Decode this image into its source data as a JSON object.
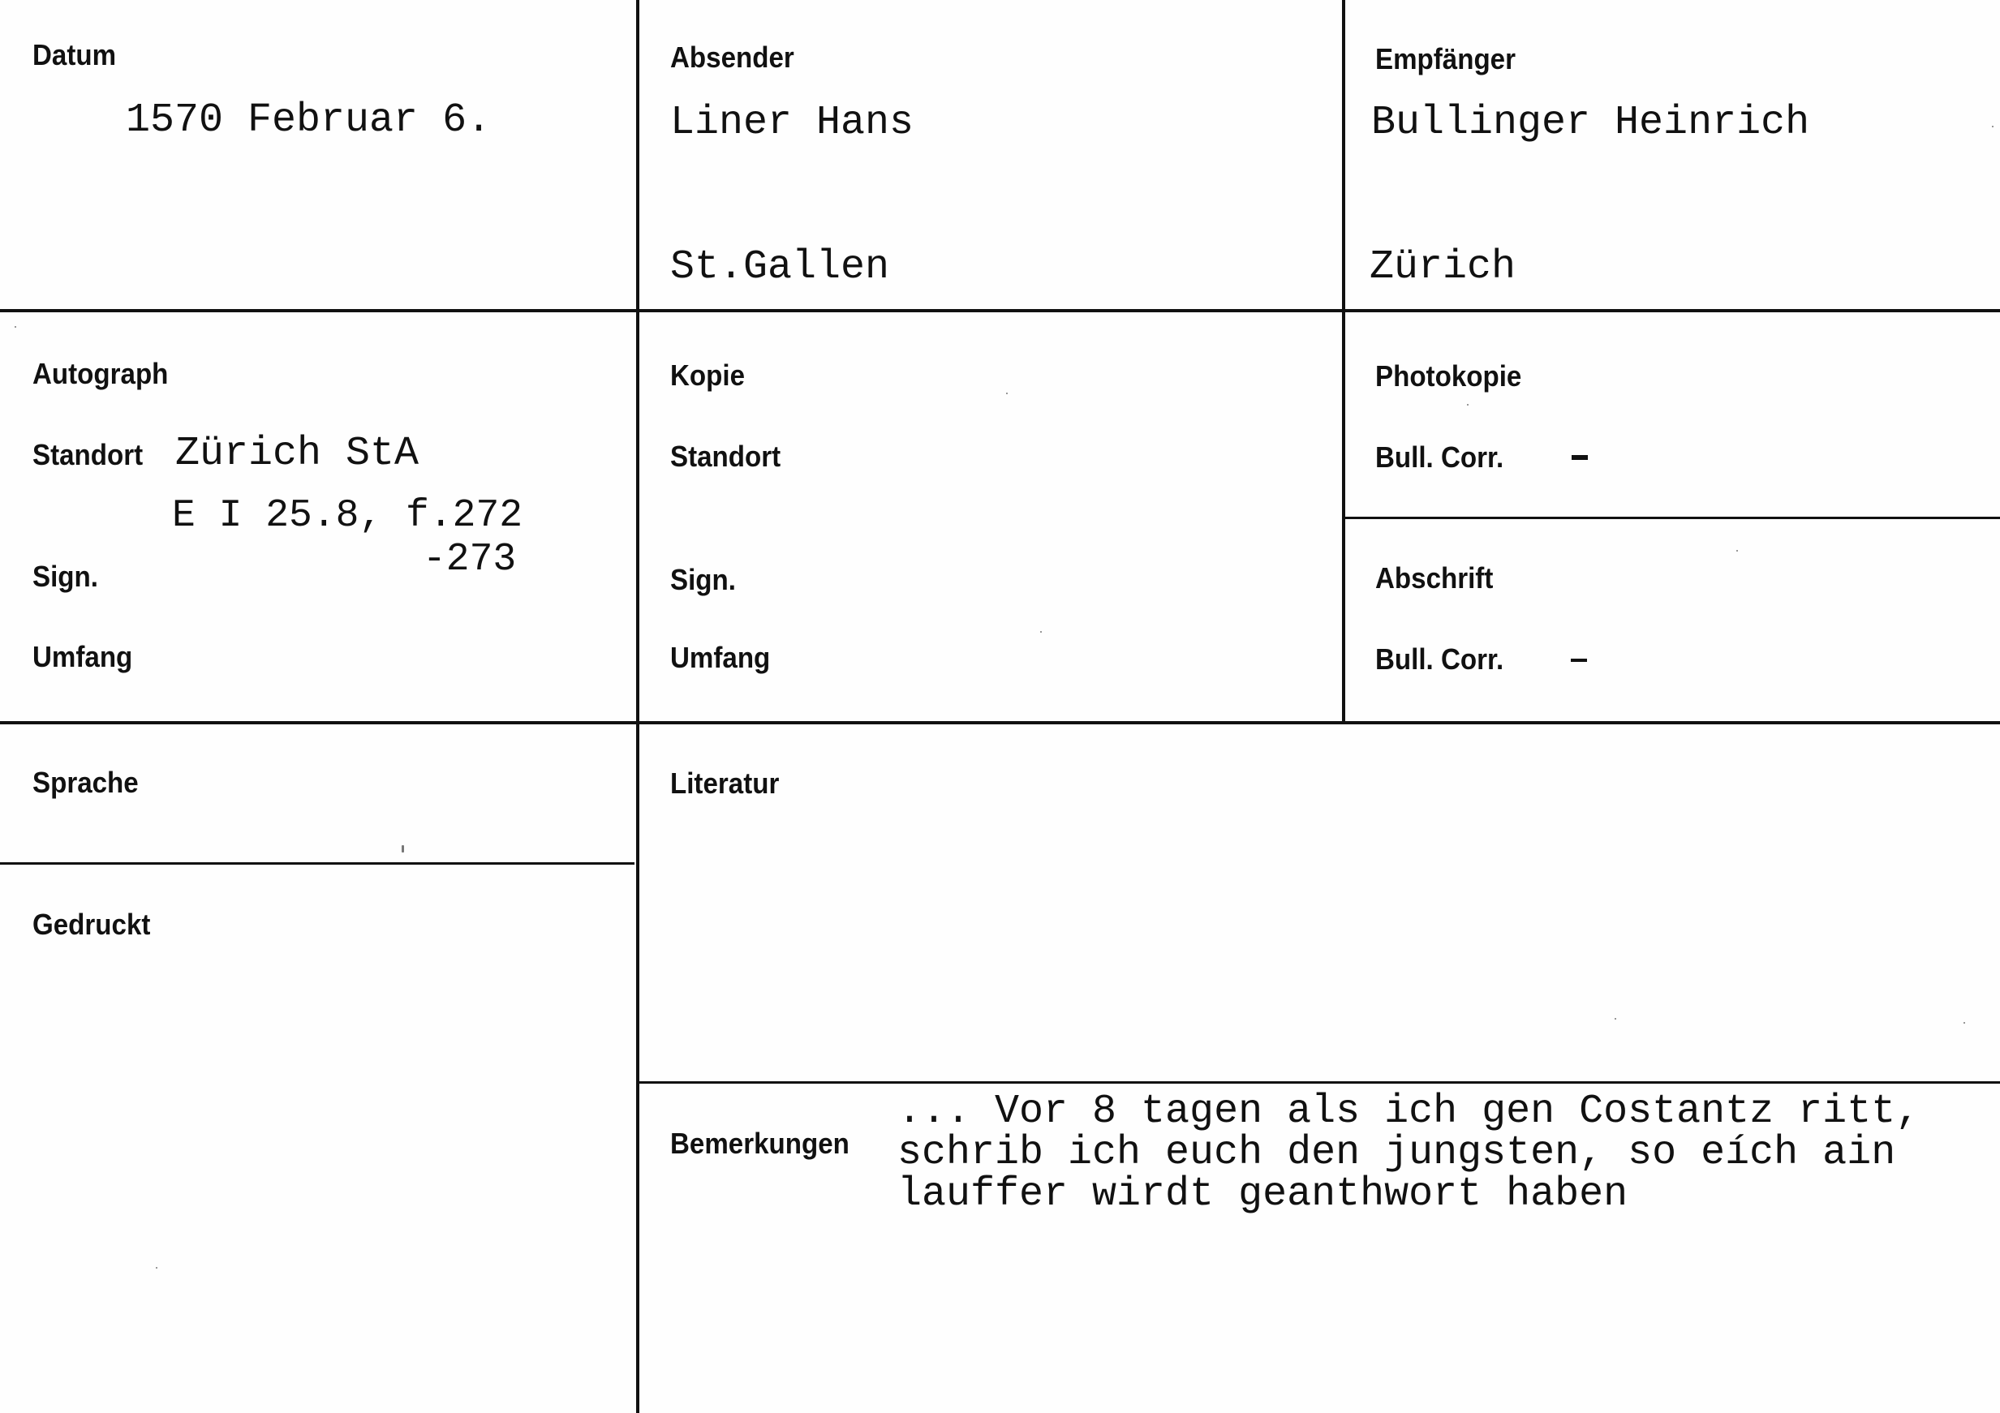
{
  "card": {
    "datum": {
      "label": "Datum",
      "value": "1570 Februar 6."
    },
    "absender": {
      "label": "Absender",
      "name": "Liner Hans",
      "place": "St.Gallen"
    },
    "empfaenger": {
      "label": "Empfänger",
      "name": "Bullinger Heinrich",
      "place": "Zürich"
    },
    "autograph": {
      "label": "Autograph",
      "standort_label": "Standort",
      "standort_value": "Zürich StA",
      "signatur_line1": "E I 25.8, f.272",
      "signatur_line2": "-273",
      "sign_label": "Sign.",
      "umfang_label": "Umfang"
    },
    "kopie": {
      "label": "Kopie",
      "standort_label": "Standort",
      "sign_label": "Sign.",
      "umfang_label": "Umfang"
    },
    "photokopie": {
      "label": "Photokopie",
      "bull_corr_label": "Bull. Corr."
    },
    "abschrift": {
      "label": "Abschrift",
      "bull_corr_label": "Bull. Corr."
    },
    "sprache": {
      "label": "Sprache"
    },
    "gedruckt": {
      "label": "Gedruckt"
    },
    "literatur": {
      "label": "Literatur"
    },
    "bemerkungen": {
      "label": "Bemerkungen",
      "lines": [
        "... Vor 8 tagen als ich gen Costantz ritt,",
        "schrib ich euch den jungsten, so eích ain",
        "lauffer wirdt geanthwort haben"
      ]
    }
  }
}
